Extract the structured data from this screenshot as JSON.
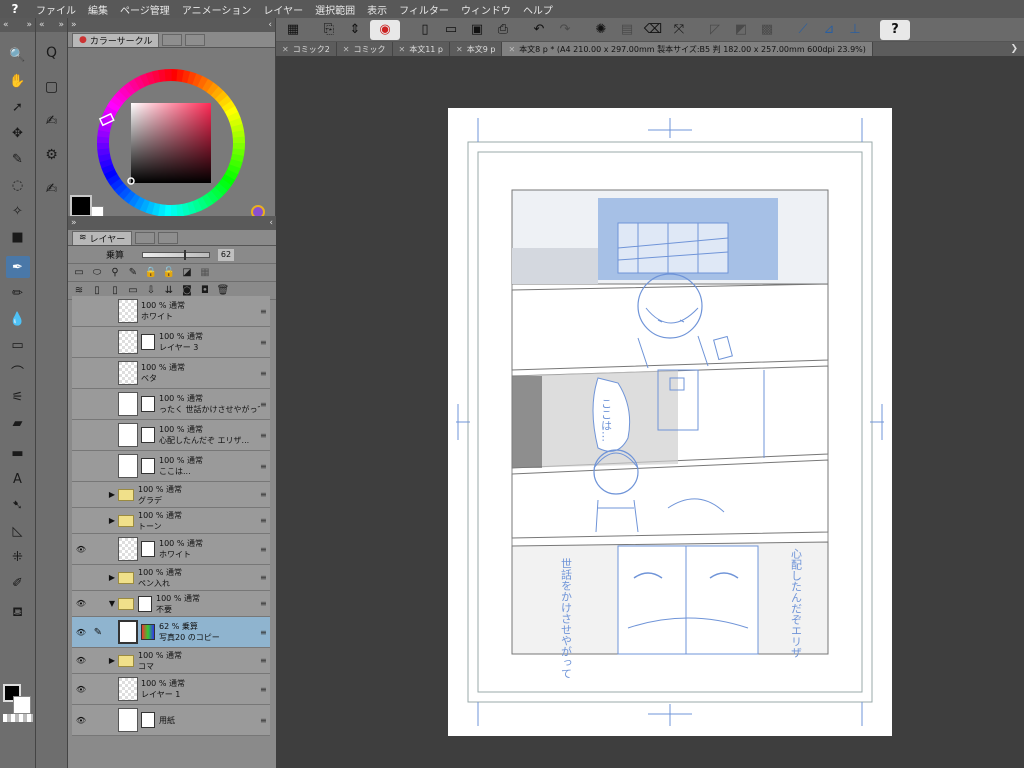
{
  "menubar": {
    "logo": "?",
    "items": [
      "ファイル",
      "編集",
      "ページ管理",
      "アニメーション",
      "レイヤー",
      "選択範囲",
      "表示",
      "フィルター",
      "ウィンドウ",
      "ヘルプ"
    ]
  },
  "colorpanel": {
    "tab_label": "カラーサークル",
    "hue": "349",
    "sat": "0",
    "val": "0"
  },
  "layerpanel": {
    "tab_label": "レイヤー",
    "blend_mode": "乗算",
    "opacity_value": 62,
    "opacity": "62",
    "layers": [
      {
        "line1": "100 % 通常",
        "line2": "ホワイト"
      },
      {
        "line1": "100 % 通常",
        "line2": "レイヤー 3"
      },
      {
        "line1": "100 % 通常",
        "line2": "ベタ"
      },
      {
        "line1": "100 % 通常",
        "line2": "ったく 世話かけさせやがって"
      },
      {
        "line1": "100 % 通常",
        "line2": "心配したんだぞ エリザ..."
      },
      {
        "line1": "100 % 通常",
        "line2": "ここは..."
      },
      {
        "line1": "100 % 通常",
        "line2": "グラデ"
      },
      {
        "line1": "100 % 通常",
        "line2": "トーン"
      },
      {
        "line1": "100 % 通常",
        "line2": "ホワイト"
      },
      {
        "line1": "100 % 通常",
        "line2": "ペン入れ"
      },
      {
        "line1": "100 % 通常",
        "line2": "不要"
      },
      {
        "line1": "62 % 乗算",
        "line2": "写真20 のコピー"
      },
      {
        "line1": "100 % 通常",
        "line2": "コマ"
      },
      {
        "line1": "100 % 通常",
        "line2": "レイヤー 1"
      },
      {
        "line1": "",
        "line2": "用紙"
      }
    ]
  },
  "tabs": [
    {
      "label": "コミック2"
    },
    {
      "label": "コミック"
    },
    {
      "label": "本文11 p"
    },
    {
      "label": "本文9 p"
    },
    {
      "label": "本文8 p * (A4 210.00 x 297.00mm 製本サイズ:B5 判 182.00 x 257.00mm 600dpi 23.9%)"
    }
  ],
  "canvas": {
    "texts": [
      "ここは…",
      "世話をかけさせやがって",
      "心配したんだぞエリザ"
    ]
  },
  "colors": {
    "menubar_bg": "#585858",
    "accent_blue": "#4a78a8",
    "selected_layer": "#8fb4cf",
    "sketch_blue": "#6f94d8"
  }
}
